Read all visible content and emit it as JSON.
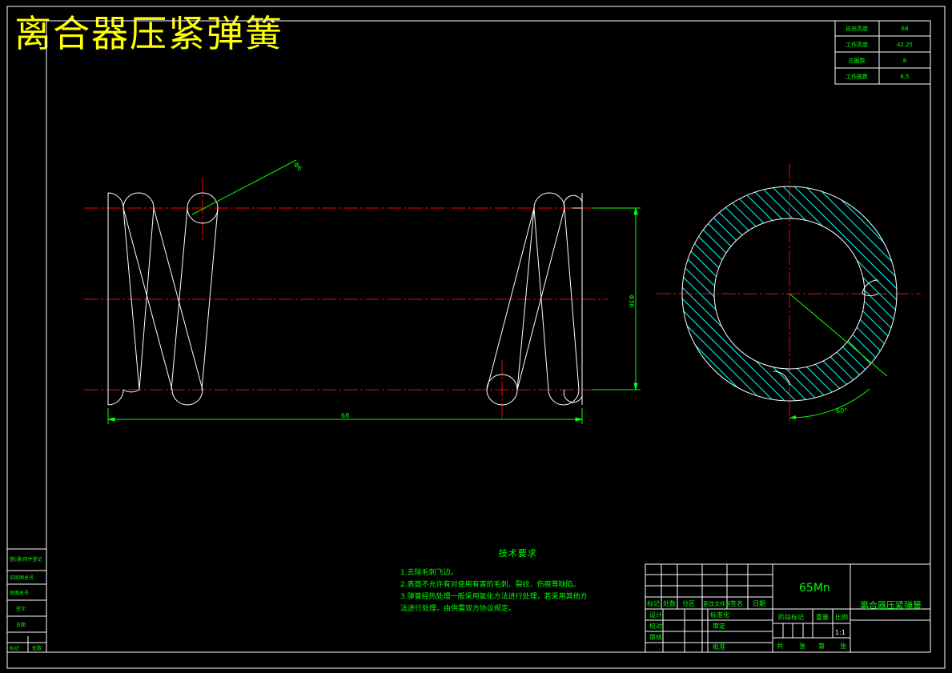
{
  "title": "离合器压紧弹簧",
  "param_table": [
    {
      "label": "自由高度",
      "value": "68"
    },
    {
      "label": "工作高度",
      "value": "42.25"
    },
    {
      "label": "总圈数",
      "value": "8"
    },
    {
      "label": "工作圈数",
      "value": "6.5"
    }
  ],
  "dimensions": {
    "wire_diameter": "Φ6",
    "coil_diameter": "Φ36",
    "free_length": "68",
    "end_angle": "60°"
  },
  "tech_requirements": {
    "heading": "技术要求",
    "items": [
      "1.去除毛刺飞边。",
      "2.表面不允许有对使用有害的毛刺、裂纹、伤痕等缺陷。",
      "3.弹簧经热处理一般采用氧化方法进行处理，若采用其他方",
      "法进行处理，由供需双方协议规定。"
    ]
  },
  "title_block": {
    "material": "65Mn",
    "part_name": "离合器压紧弹簧",
    "scale": "1:1",
    "headers": [
      "标记",
      "处数",
      "分区",
      "更改文件号",
      "签名",
      "日期"
    ],
    "roles": [
      "设计",
      "校对",
      "审核"
    ],
    "std_label": "标准化",
    "review_label": "审定",
    "approve_label": "批准",
    "stage_label": "阶段标记",
    "weight_label": "重量",
    "scale_label": "比例",
    "sheets": [
      "共",
      "张",
      "第",
      "张"
    ]
  },
  "side_column": [
    "借(通)用件登记",
    "旧底图总号",
    "底图总号",
    "签字",
    "日期",
    "标记",
    "处数"
  ],
  "colors": {
    "background": "#000000",
    "frame": "#ffffff",
    "title": "#ffff00",
    "dimension": "#00ff00",
    "centerline": "#ff0000",
    "hatch": "#00ffff"
  }
}
